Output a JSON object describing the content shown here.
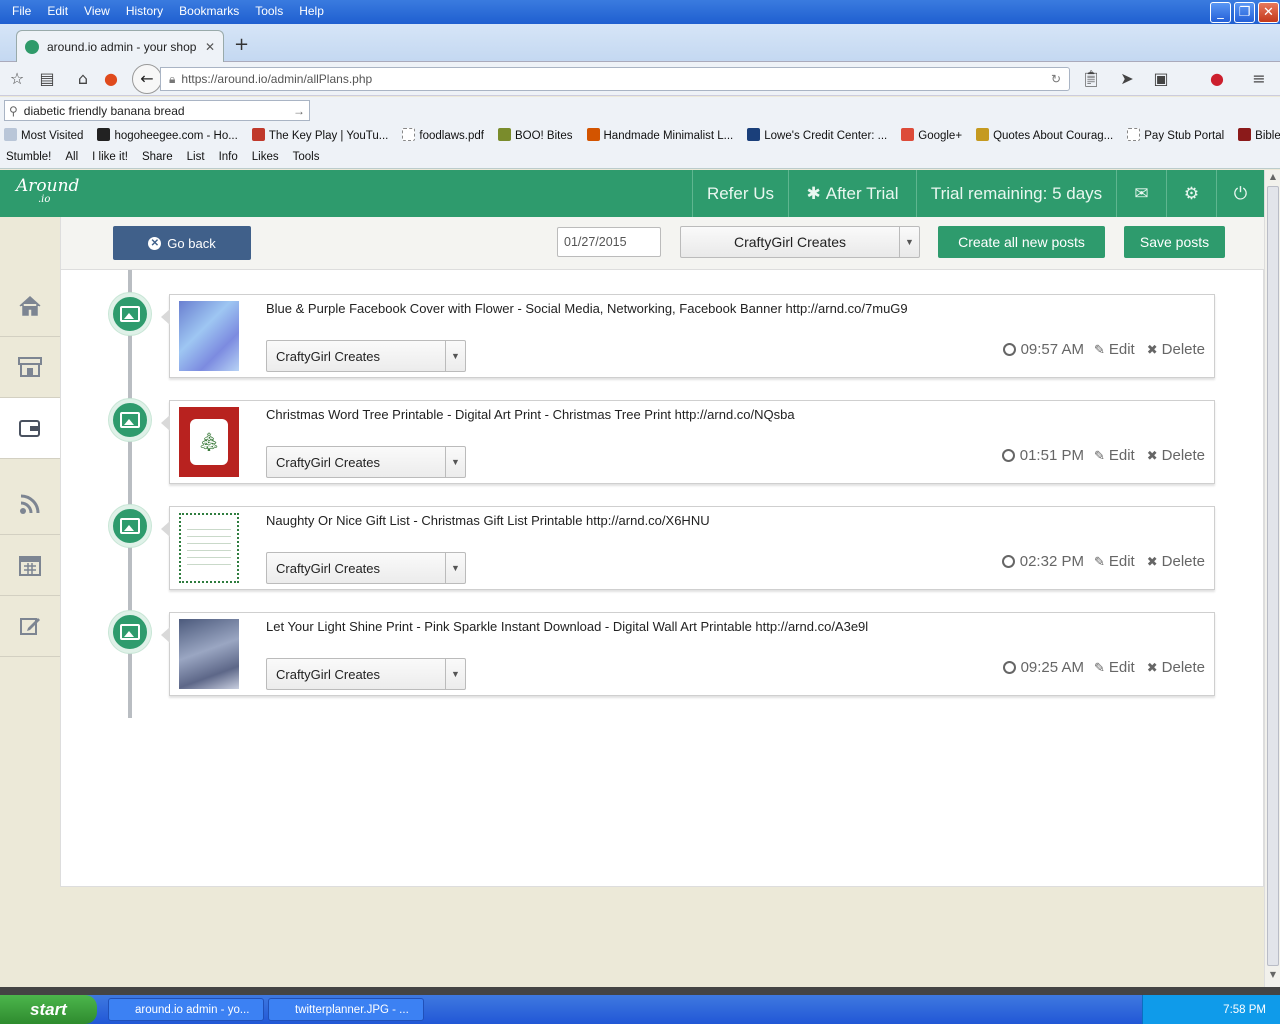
{
  "window": {
    "menu": [
      "File",
      "Edit",
      "View",
      "History",
      "Bookmarks",
      "Tools",
      "Help"
    ],
    "controls": [
      "minimize",
      "maximize",
      "close"
    ]
  },
  "browser": {
    "tab_title": "around.io admin - your shop",
    "url": "https://around.io/admin/allPlans.php",
    "search_value": "diabetic friendly banana bread",
    "bookmarks": [
      "Most Visited",
      "hogoheegee.com - Ho...",
      "The Key Play | YouTu...",
      "foodlaws.pdf",
      "BOO! Bites",
      "Handmade Minimalist L...",
      "Lowe's Credit Center: ...",
      "Google+",
      "Quotes About Courag...",
      "Pay Stub Portal",
      "Bible Gateway"
    ],
    "stumble_bar": [
      "Stumble!",
      "All",
      "I like it!",
      "Share",
      "List",
      "Info",
      "Likes",
      "Tools"
    ]
  },
  "app": {
    "logo": "Around",
    "logo_sub": ".io",
    "header": {
      "refer": "Refer Us",
      "after_trial": "After Trial",
      "trial_remaining": "Trial remaining: 5 days"
    },
    "toolbar": {
      "go_back": "Go back",
      "date": "01/27/2015",
      "shop": "CraftyGirl Creates",
      "create_all": "Create all new posts",
      "save": "Save posts"
    },
    "sidebar": [
      "home-icon",
      "store-icon",
      "wallet-icon",
      "rss-icon",
      "calendar-icon",
      "edit-icon"
    ],
    "posts": [
      {
        "title": "Blue & Purple Facebook Cover with Flower - Social Media, Networking, Facebook Banner http://arnd.co/7muG9",
        "account": "CraftyGirl Creates",
        "time": "09:57 AM",
        "edit": "Edit",
        "delete": "Delete"
      },
      {
        "title": "Christmas Word Tree Printable - Digital Art Print - Christmas Tree Print http://arnd.co/NQsba",
        "account": "CraftyGirl Creates",
        "time": "01:51 PM",
        "edit": "Edit",
        "delete": "Delete"
      },
      {
        "title": "Naughty Or Nice Gift List - Christmas Gift List Printable http://arnd.co/X6HNU",
        "account": "CraftyGirl Creates",
        "time": "02:32 PM",
        "edit": "Edit",
        "delete": "Delete"
      },
      {
        "title": "Let Your Light Shine Print - Pink Sparkle Instant Download - Digital Wall Art Printable http://arnd.co/A3e9l",
        "account": "CraftyGirl Creates",
        "time": "09:25 AM",
        "edit": "Edit",
        "delete": "Delete"
      }
    ]
  },
  "taskbar": {
    "start": "start",
    "items": [
      "around.io admin - yo...",
      "twitterplanner.JPG - ..."
    ],
    "clock": "7:58 PM"
  },
  "colors": {
    "brand_green": "#2e9b6d",
    "go_back_blue": "#40608a"
  }
}
